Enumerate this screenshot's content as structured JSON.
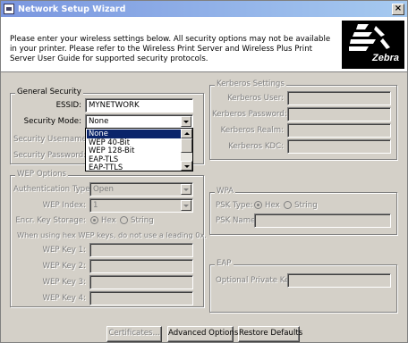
{
  "window": {
    "title": "Network Setup Wizard",
    "close_glyph": "×"
  },
  "header": {
    "intro": "Please enter your wireless settings below.  All security options may not be available in your printer. Please refer to the Wireless Print Server and Wireless Plus Print Server User Guide for supported security protocols.",
    "logo_text": "Zebra",
    "logo_icon": "zebra-head-icon"
  },
  "general_security": {
    "title": "General Security",
    "essid_label": "ESSID:",
    "essid_value": "MYNETWORK",
    "security_mode_label": "Security Mode:",
    "security_mode_value": "None",
    "security_mode_options": [
      "None",
      "WEP 40-Bit",
      "WEP 128-Bit",
      "EAP-TLS",
      "EAP-TTLS"
    ],
    "security_username_label": "Security Username:",
    "security_password_label": "Security Password:"
  },
  "wep_options": {
    "title": "WEP Options",
    "auth_type_label": "Authentication Type:",
    "auth_type_value": "Open",
    "wep_index_label": "WEP Index:",
    "wep_index_value": "1",
    "key_storage_label": "Encr. Key Storage:",
    "hex_label": "Hex",
    "string_label": "String",
    "hex_note": "When using hex WEP keys, do not use a leading 0x.",
    "key1_label": "WEP Key 1:",
    "key2_label": "WEP Key 2:",
    "key3_label": "WEP Key 3:",
    "key4_label": "WEP Key 4:"
  },
  "kerberos": {
    "title": "Kerberos Settings",
    "user_label": "Kerberos User:",
    "password_label": "Kerberos Password:",
    "realm_label": "Kerberos Realm:",
    "kdc_label": "Kerberos KDC:"
  },
  "wpa": {
    "title": "WPA",
    "psk_type_label": "PSK Type:",
    "hex_label": "Hex",
    "string_label": "String",
    "psk_name_label": "PSK Name:"
  },
  "eap": {
    "title": "EAP",
    "private_key_label": "Optional Private Key:"
  },
  "buttons": {
    "certificates": "Certificates...",
    "advanced": "Advanced Options",
    "restore": "Restore Defaults"
  }
}
